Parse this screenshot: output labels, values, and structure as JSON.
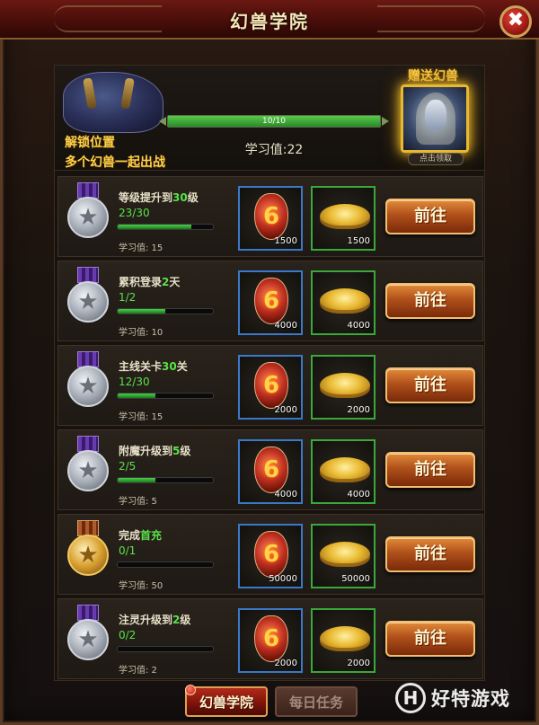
{
  "window": {
    "title": "幻兽学院",
    "close_icon": "✖"
  },
  "header": {
    "unlock_line1": "解锁位置",
    "unlock_line2": "多个幻兽一起出战",
    "progress_text": "10/10",
    "progress_fraction": 1.0,
    "study_total": "学习值:22",
    "gift_title": "赠送幻兽",
    "claim_label": "点击领取"
  },
  "tasks": [
    {
      "title_pre": "等级提升到",
      "title_hl": "30",
      "title_post": "级",
      "progress": "23/30",
      "progress_fraction": 0.77,
      "study": "学习值: 15",
      "reward1": "1500",
      "reward2": "1500",
      "go_label": "前往",
      "medal": "silver"
    },
    {
      "title_pre": "累积登录",
      "title_hl": "2",
      "title_post": "天",
      "progress": "1/2",
      "progress_fraction": 0.5,
      "study": "学习值: 10",
      "reward1": "4000",
      "reward2": "4000",
      "go_label": "前往",
      "medal": "silver"
    },
    {
      "title_pre": "主线关卡",
      "title_hl": "30",
      "title_post": "关",
      "progress": "12/30",
      "progress_fraction": 0.4,
      "study": "学习值: 15",
      "reward1": "2000",
      "reward2": "2000",
      "go_label": "前往",
      "medal": "silver"
    },
    {
      "title_pre": "附魔升级到",
      "title_hl": "5",
      "title_post": "级",
      "progress": "2/5",
      "progress_fraction": 0.4,
      "study": "学习值: 5",
      "reward1": "4000",
      "reward2": "4000",
      "go_label": "前往",
      "medal": "silver"
    },
    {
      "title_pre": "完成",
      "title_hl": "首充",
      "title_post": "",
      "progress": "0/1",
      "progress_fraction": 0.0,
      "study": "学习值: 50",
      "reward1": "50000",
      "reward2": "50000",
      "go_label": "前往",
      "medal": "gold"
    },
    {
      "title_pre": "注灵升级到",
      "title_hl": "2",
      "title_post": "级",
      "progress": "0/2",
      "progress_fraction": 0.0,
      "study": "学习值: 2",
      "reward1": "2000",
      "reward2": "2000",
      "go_label": "前往",
      "medal": "silver"
    }
  ],
  "tabs": {
    "active": "幻兽学院",
    "inactive": "每日任务"
  },
  "watermark": {
    "logo": "H",
    "text": "好特游戏"
  },
  "icons": {
    "star": "★",
    "crystal_glyph": "6"
  }
}
